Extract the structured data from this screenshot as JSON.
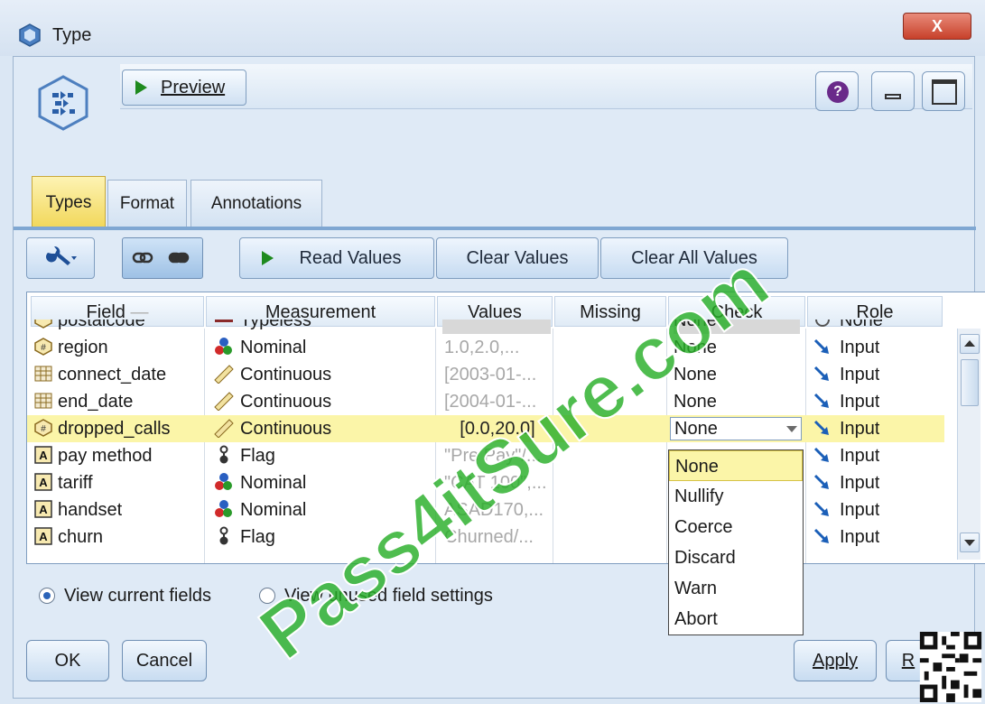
{
  "window": {
    "title": "Type",
    "close_label": "X"
  },
  "toolbar_top": {
    "preview_label": "Preview",
    "help_label": "?"
  },
  "tabs": [
    {
      "label": "Types",
      "active": true
    },
    {
      "label": "Format",
      "active": false
    },
    {
      "label": "Annotations",
      "active": false
    }
  ],
  "toolbar": {
    "read_values": "Read Values",
    "clear_values": "Clear Values",
    "clear_all_values": "Clear All Values"
  },
  "table": {
    "columns": [
      "Field",
      "Measurement",
      "Values",
      "Missing",
      "Check",
      "Role"
    ],
    "rows": [
      {
        "field": "postalcode",
        "field_icon": "string-field-icon",
        "measurement": "Typeless",
        "values": "",
        "missing": "",
        "check": "None",
        "role": "None"
      },
      {
        "field": "region",
        "field_icon": "numeric-field-icon",
        "measurement": "Nominal",
        "values": "1.0,2.0,...",
        "missing": "",
        "check": "None",
        "role": "Input"
      },
      {
        "field": "connect_date",
        "field_icon": "date-field-icon",
        "measurement": "Continuous",
        "values": "[2003-01-...",
        "missing": "",
        "check": "None",
        "role": "Input"
      },
      {
        "field": "end_date",
        "field_icon": "date-field-icon",
        "measurement": "Continuous",
        "values": "[2004-01-...",
        "missing": "",
        "check": "None",
        "role": "Input"
      },
      {
        "field": "dropped_calls",
        "field_icon": "numeric-field-icon",
        "measurement": "Continuous",
        "values": "[0.0,20.0]",
        "missing": "",
        "check": "None",
        "role": "Input",
        "selected": true
      },
      {
        "field": "pay method",
        "field_icon": "string-field-icon",
        "measurement": "Flag",
        "values": "\"Pre Pay\"/...",
        "missing": "",
        "check": "",
        "role": "Input"
      },
      {
        "field": "tariff",
        "field_icon": "string-field-icon",
        "measurement": "Nominal",
        "values": "\"CAT 100\",...",
        "missing": "",
        "check": "",
        "role": "Input"
      },
      {
        "field": "handset",
        "field_icon": "string-field-icon",
        "measurement": "Nominal",
        "values": "ASAD170,...",
        "missing": "",
        "check": "",
        "role": "Input"
      },
      {
        "field": "churn",
        "field_icon": "string-field-icon",
        "measurement": "Flag",
        "values": "Churned/...",
        "missing": "",
        "check": "",
        "role": "Input"
      }
    ]
  },
  "check_dropdown": {
    "selected": "None",
    "options": [
      "None",
      "Nullify",
      "Coerce",
      "Discard",
      "Warn",
      "Abort"
    ]
  },
  "view_options": {
    "current_fields": "View current fields",
    "unused_fields": "View unused field settings",
    "selected": "current_fields"
  },
  "buttons": {
    "ok": "OK",
    "cancel": "Cancel",
    "apply": "Apply",
    "reset": "R"
  },
  "watermark": "Pass4itSure.com",
  "colors": {
    "selected_row": "#fbf5a8",
    "active_tab": "#f2d85c",
    "role_arrow": "#1b5fb8",
    "watermark": "#28af28"
  }
}
